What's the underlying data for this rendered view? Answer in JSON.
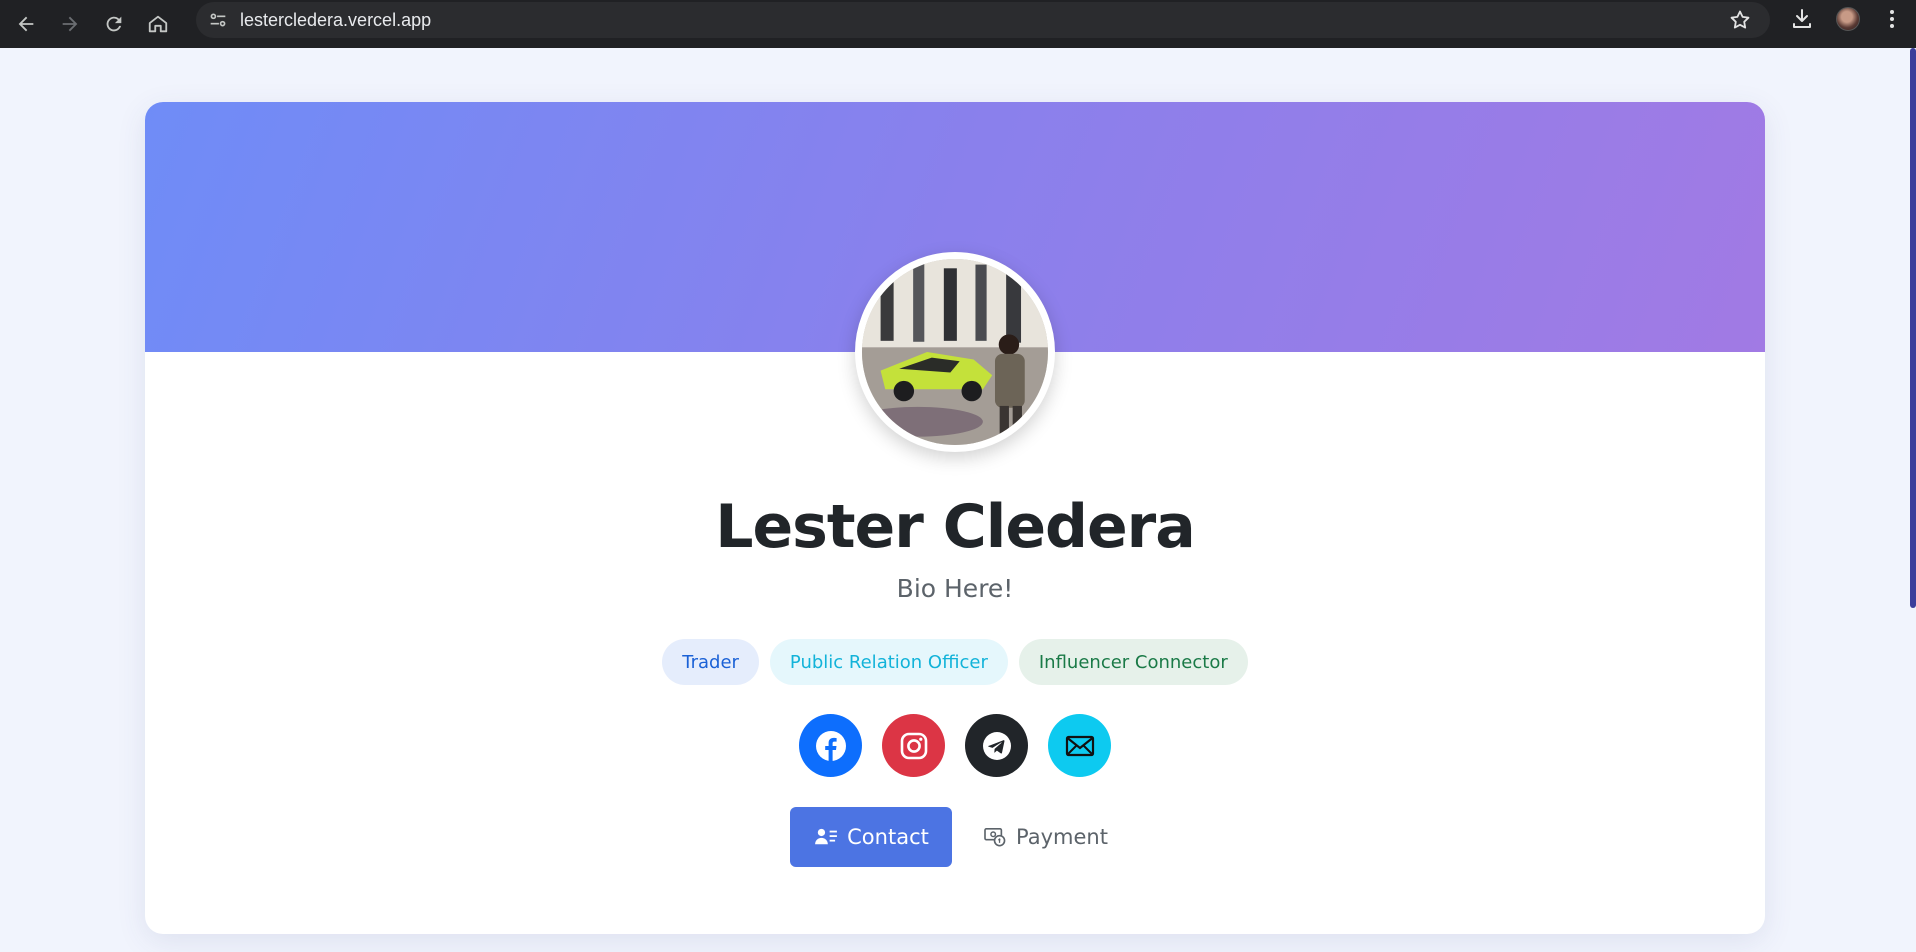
{
  "browser": {
    "url": "lestercledera.vercel.app",
    "nav_icons": [
      "back-arrow-icon",
      "forward-arrow-icon",
      "reload-icon",
      "home-icon"
    ],
    "right_icons": [
      "bookmark-star-icon",
      "download-icon",
      "profile-avatar",
      "more-menu-icon"
    ]
  },
  "profile": {
    "name": "Lester Cledera",
    "bio": "Bio Here!",
    "tags": [
      {
        "label": "Trader",
        "color": "#1a61d6",
        "background": "#e5edfc"
      },
      {
        "label": "Public Relation Officer",
        "color": "#12b3d9",
        "background": "#e5f7fc"
      },
      {
        "label": "Influencer Connector",
        "color": "#1a7a47",
        "background": "#e6f1ea"
      }
    ],
    "socials": [
      {
        "icon": "facebook-icon",
        "color": "#0d6efd"
      },
      {
        "icon": "instagram-icon",
        "color": "#dc3545"
      },
      {
        "icon": "telegram-icon",
        "color": "#212529"
      },
      {
        "icon": "envelope-icon",
        "color": "#0dcaf0"
      }
    ],
    "actions": {
      "contact_label": "Contact",
      "payment_label": "Payment"
    }
  },
  "colors": {
    "banner_gradient_start": "#6f8cf7",
    "banner_gradient_end": "#a17ae4",
    "primary": "#4c74e3"
  }
}
